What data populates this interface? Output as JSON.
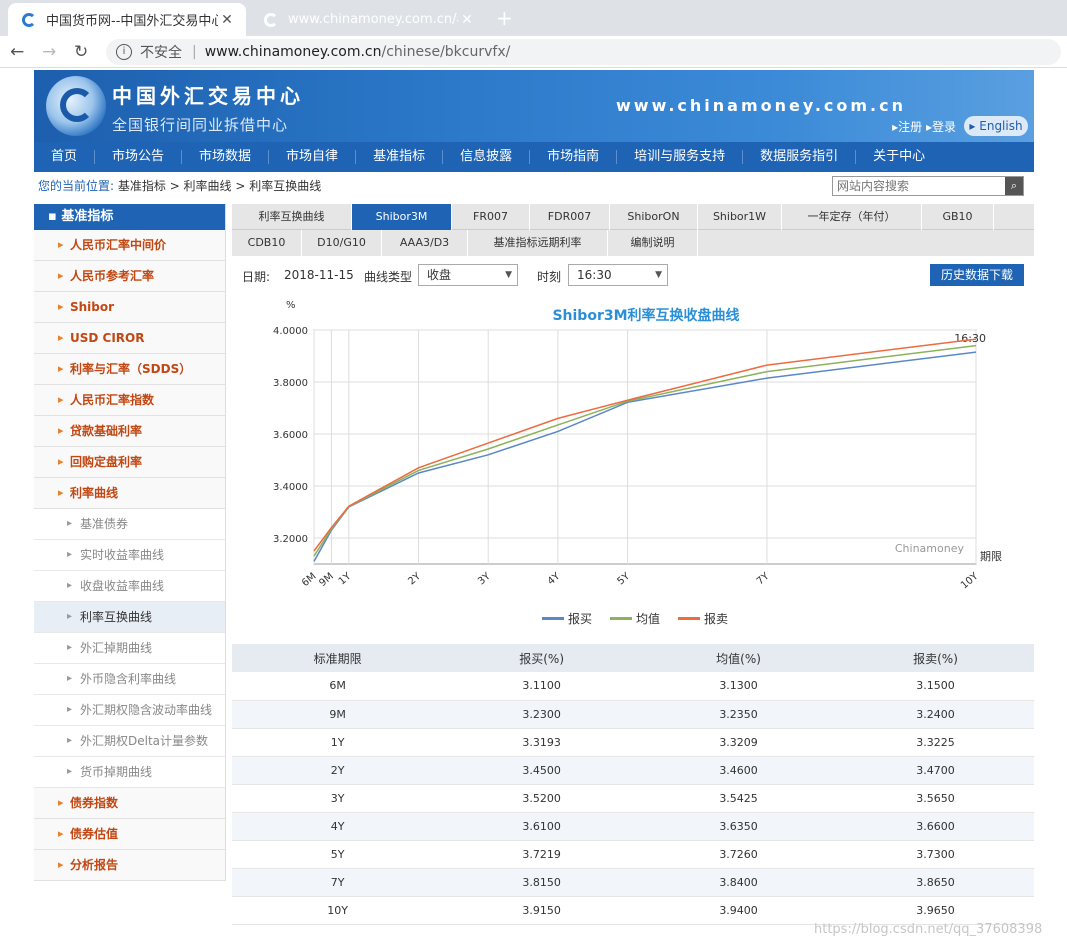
{
  "browser": {
    "tabs": [
      {
        "title": "中国货币网--中国外汇交易中心主"
      },
      {
        "title": "www.chinamoney.com.cn/ags/"
      }
    ],
    "security": "不安全",
    "url_host": "www.chinamoney.com.cn",
    "url_path": "/chinese/bkcurvfx/"
  },
  "header": {
    "logo_cn": "中国外汇交易中心",
    "logo_sub": "全国银行间同业拆借中心",
    "site_url": "www.chinamoney.com.cn",
    "register": "注册",
    "login": "登录",
    "english": "English"
  },
  "mainnav": [
    "首页",
    "市场公告",
    "市场数据",
    "市场自律",
    "基准指标",
    "信息披露",
    "市场指南",
    "培训与服务支持",
    "数据服务指引",
    "关于中心"
  ],
  "breadcrumb": {
    "label": "您的当前位置:",
    "path": "基准指标 > 利率曲线 > 利率互换曲线"
  },
  "search": {
    "placeholder": "网站内容搜索"
  },
  "sidebar": {
    "head": "基准指标",
    "items": [
      "人民币汇率中间价",
      "人民币参考汇率",
      "Shibor",
      "USD CIROR",
      "利率与汇率（SDDS）",
      "人民币汇率指数",
      "贷款基础利率",
      "回购定盘利率",
      "利率曲线"
    ],
    "subitems": [
      "基准债券",
      "实时收益率曲线",
      "收盘收益率曲线",
      "利率互换曲线",
      "外汇掉期曲线",
      "外币隐含利率曲线",
      "外汇期权隐含波动率曲线",
      "外汇期权Delta计量参数",
      "货币掉期曲线"
    ],
    "items_after": [
      "债券指数",
      "债券估值",
      "分析报告"
    ]
  },
  "tabs_row1": [
    "利率互换曲线",
    "Shibor3M",
    "FR007",
    "FDR007",
    "ShiborON",
    "Shibor1W",
    "一年定存（年付）",
    "GB10"
  ],
  "tabs_row2": [
    "CDB10",
    "D10/G10",
    "AAA3/D3",
    "基准指标远期利率",
    "编制说明"
  ],
  "filter": {
    "date_label": "日期:",
    "date": "2018-11-15",
    "curve_label": "曲线类型",
    "curve_value": "收盘",
    "time_label": "时刻",
    "time_value": "16:30",
    "download": "历史数据下载"
  },
  "chart_data": {
    "type": "line",
    "title": "Shibor3M利率互换收盘曲线",
    "ylabel": "%",
    "xlabel": "期限",
    "time_stamp": "16:30",
    "watermark": "Chinamoney",
    "categories": [
      "6M",
      "9M",
      "1Y",
      "2Y",
      "3Y",
      "4Y",
      "5Y",
      "7Y",
      "10Y"
    ],
    "x_years": [
      0.5,
      0.75,
      1,
      2,
      3,
      4,
      5,
      7,
      10
    ],
    "ylim": [
      3.1,
      4.0
    ],
    "yticks": [
      "4.0000",
      "3.8000",
      "3.6000",
      "3.4000",
      "3.2000"
    ],
    "series": [
      {
        "name": "报买",
        "color": "#5b87c9",
        "values": [
          3.11,
          3.23,
          3.3193,
          3.45,
          3.52,
          3.61,
          3.7219,
          3.815,
          3.915
        ]
      },
      {
        "name": "均值",
        "color": "#8cb25a",
        "values": [
          3.13,
          3.235,
          3.3209,
          3.46,
          3.5425,
          3.635,
          3.726,
          3.84,
          3.94
        ]
      },
      {
        "name": "报卖",
        "color": "#ec6b3f",
        "values": [
          3.15,
          3.24,
          3.3225,
          3.47,
          3.565,
          3.66,
          3.73,
          3.865,
          3.965
        ]
      }
    ]
  },
  "table": {
    "headers": [
      "标准期限",
      "报买(%)",
      "均值(%)",
      "报卖(%)"
    ],
    "rows": [
      [
        "6M",
        "3.1100",
        "3.1300",
        "3.1500"
      ],
      [
        "9M",
        "3.2300",
        "3.2350",
        "3.2400"
      ],
      [
        "1Y",
        "3.3193",
        "3.3209",
        "3.3225"
      ],
      [
        "2Y",
        "3.4500",
        "3.4600",
        "3.4700"
      ],
      [
        "3Y",
        "3.5200",
        "3.5425",
        "3.5650"
      ],
      [
        "4Y",
        "3.6100",
        "3.6350",
        "3.6600"
      ],
      [
        "5Y",
        "3.7219",
        "3.7260",
        "3.7300"
      ],
      [
        "7Y",
        "3.8150",
        "3.8400",
        "3.8650"
      ],
      [
        "10Y",
        "3.9150",
        "3.9400",
        "3.9650"
      ]
    ]
  },
  "watermark": "https://blog.csdn.net/qq_37608398"
}
